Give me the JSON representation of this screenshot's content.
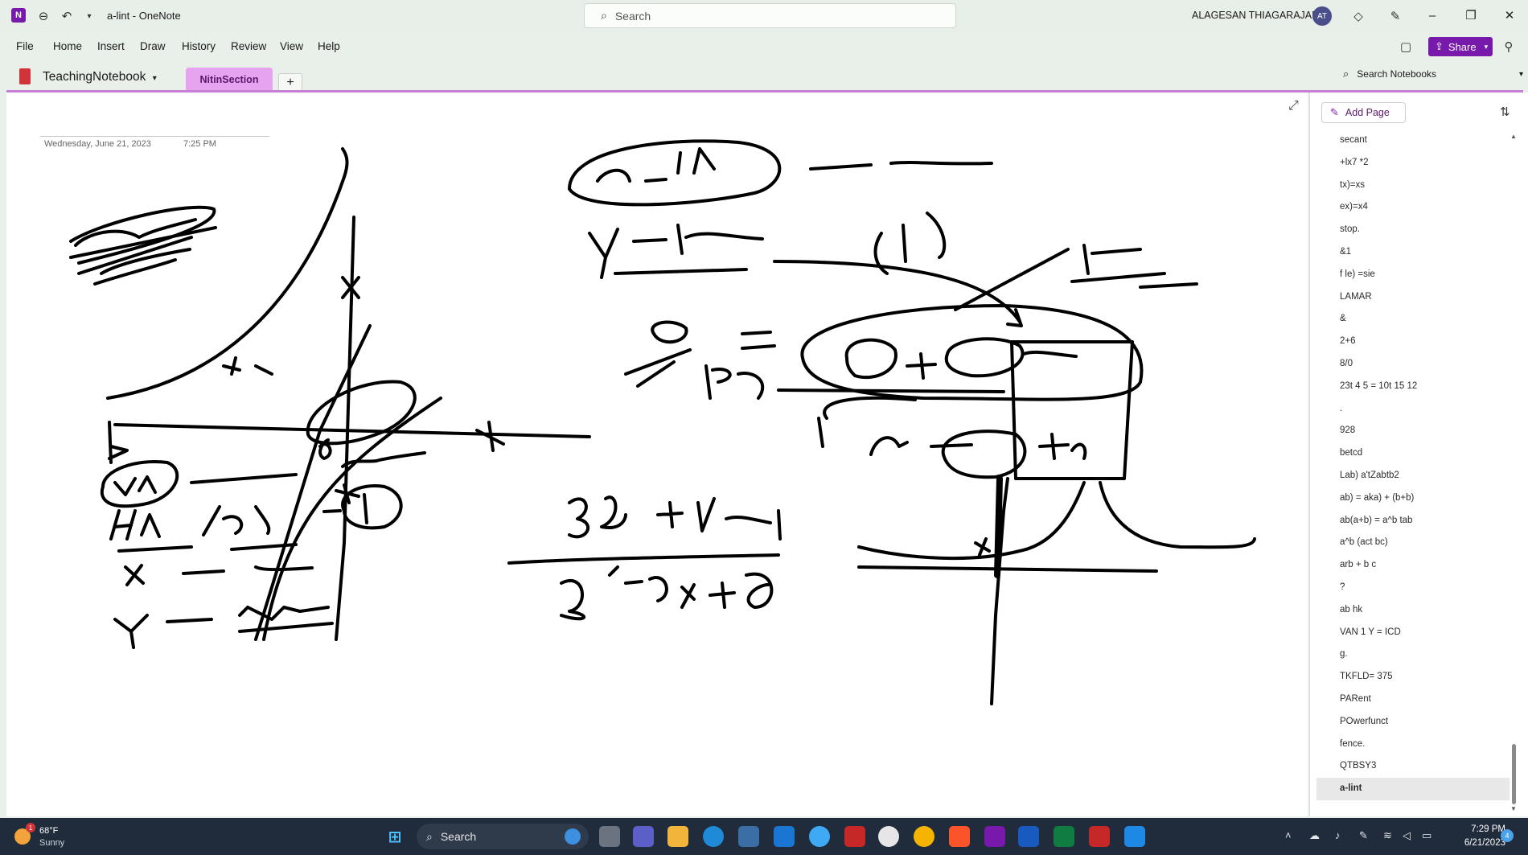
{
  "titlebar": {
    "title": "a-lint  -  OneNote",
    "app_letter": "N",
    "search_placeholder": "Search",
    "user_name": "ALAGESAN THIAGARAJAN",
    "user_initials": "AT"
  },
  "menu": {
    "items": [
      "File",
      "Home",
      "Insert",
      "Draw",
      "History",
      "Review",
      "View",
      "Help"
    ],
    "share_label": "Share"
  },
  "notebook": {
    "name": "TeachingNotebook",
    "section": "NitinSection",
    "add_section": "+",
    "search_notebooks": "Search Notebooks"
  },
  "page": {
    "date": "Wednesday, June 21, 2023",
    "time": "7:25 PM"
  },
  "page_list": {
    "add_page_label": "Add Page",
    "pages": [
      "secant",
      "+lx7 *2",
      "tx)=xs",
      "ex)=x4",
      "stop.",
      "&1",
      "f le) =sie",
      "LAMAR",
      "&",
      "2+6",
      "8/0",
      "23t 4 5 = 10t 15 12",
      ".",
      "928",
      "betcd",
      "Lab) a'tZabtb2",
      "ab) = aka) + (b+b)",
      "ab(a+b) = a^b tab",
      "a^b (act bc)",
      "arb + b c",
      "?",
      "ab hk",
      "VAN 1 Y = ICD",
      "g.",
      "TKFLD= 375",
      "PARent",
      "POwerfunct",
      "fence.",
      "QTBSY3",
      "a-lint"
    ],
    "active_index": 29
  },
  "taskbar": {
    "weather_temp": "68°F",
    "weather_desc": "Sunny",
    "weather_badge": "1",
    "search_label": "Search",
    "clock_time": "7:29 PM",
    "clock_date": "6/21/2023",
    "notifications": "4"
  },
  "colors": {
    "accent": "#7719aa",
    "section_tab": "#e6a3ef",
    "notebook_icon": "#d13438",
    "taskbar": "#202b3c"
  }
}
